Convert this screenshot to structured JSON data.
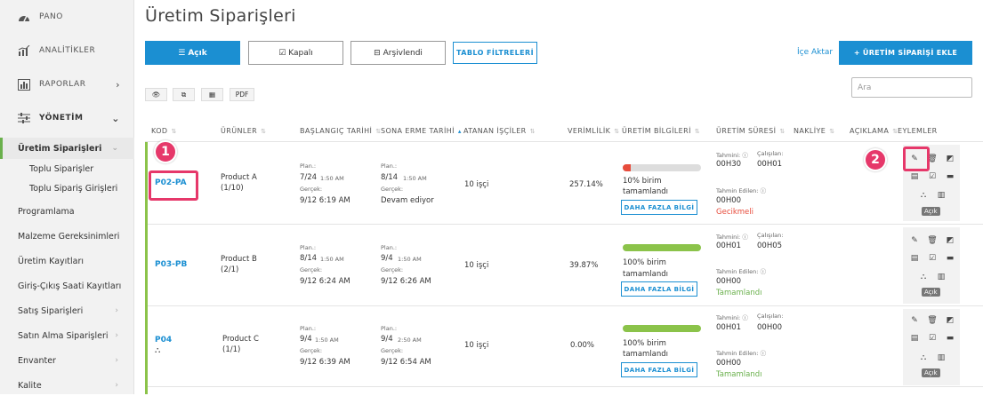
{
  "sidebar": {
    "top": [
      {
        "label": "PANO",
        "icon": "gauge-icon"
      },
      {
        "label": "ANALİTİKLER",
        "icon": "chart-icon"
      },
      {
        "label": "RAPORLAR",
        "icon": "report-icon"
      },
      {
        "label": "YÖNETİM",
        "icon": "sliders-icon"
      }
    ],
    "sub": [
      "Üretim Siparişleri",
      "Toplu Siparişler",
      "Toplu Sipariş Girişleri",
      "Programlama",
      "Malzeme Gereksinimleri",
      "Üretim Kayıtları",
      "Giriş-Çıkış Saati Kayıtları",
      "Satış Siparişleri",
      "Satın Alma Siparişleri",
      "Envanter",
      "Kalite"
    ]
  },
  "page": {
    "title": "Üretim Siparişleri"
  },
  "toolbar": {
    "open": "Açık",
    "closed": "Kapalı",
    "archived": "Arşivlendi",
    "filters": "TABLO FİLTRELERİ",
    "import": "İçe Aktar",
    "add": "+ ÜRETİM SİPARİŞİ EKLE",
    "pdf": "PDF",
    "search_placeholder": "Ara"
  },
  "columns": [
    "KOD",
    "ÜRÜNLER",
    "BAŞLANGIÇ TARİHİ",
    "SONA ERME TARİHİ",
    "ATANAN İŞÇİLER",
    "VERİMLİLİK",
    "ÜRETİM BİLGİLERİ",
    "ÜRETİM SÜRESİ",
    "NAKLİYE",
    "AÇIKLAMA",
    "EYLEMLER"
  ],
  "labels": {
    "plan": "Plan.:",
    "actual": "Gerçek:",
    "estimated": "Tahmini:",
    "worker": "Çalışılan:",
    "estimated_done": "Tahmin Edilen:",
    "more": "DAHA FAZLA BİLGİ",
    "open_badge": "Açık"
  },
  "rows": [
    {
      "code": "P02-PA",
      "product": "Product A",
      "product_qty": "(1/10)",
      "start_plan_date": "7/24",
      "start_plan_time": "1:50 AM",
      "start_actual": "9/12  6:19 AM",
      "end_plan_date": "8/14",
      "end_plan_time": "1:50 AM",
      "end_actual": "Devam ediyor",
      "workers": "10 işçi",
      "efficiency": "257.14%",
      "progress": 0.1,
      "progress_text_1": "10% birim",
      "progress_text_2": "tamamlandı",
      "est": "00H30",
      "worked": "00H01",
      "est_done": "00H00",
      "status": "Gecikmeli",
      "status_color": "#e74c3c"
    },
    {
      "code": "P03-PB",
      "product": "Product B",
      "product_qty": "(2/1)",
      "start_plan_date": "8/14",
      "start_plan_time": "1:50 AM",
      "start_actual": "9/12  6:24 AM",
      "end_plan_date": "9/4",
      "end_plan_time": "1:50 AM",
      "end_actual": "9/12  6:26 AM",
      "workers": "10 işçi",
      "efficiency": "39.87%",
      "progress": 1.0,
      "progress_text_1": "100% birim",
      "progress_text_2": "tamamlandı",
      "est": "00H01",
      "worked": "00H05",
      "est_done": "00H00",
      "status": "Tamamlandı",
      "status_color": "#6ab04c"
    },
    {
      "code": "P04",
      "product": "Product C",
      "product_qty": "(1/1)",
      "start_plan_date": "9/4",
      "start_plan_time": "1:50 AM",
      "start_actual": "9/12  6:39 AM",
      "end_plan_date": "9/4",
      "end_plan_time": "2:50 AM",
      "end_actual": "9/12  6:54 AM",
      "workers": "10 işçi",
      "efficiency": "0.00%",
      "progress": 1.0,
      "progress_text_1": "100% birim",
      "progress_text_2": "tamamlandı",
      "est": "00H01",
      "worked": "00H00",
      "est_done": "00H00",
      "status": "Tamamlandı",
      "status_color": "#6ab04c"
    }
  ],
  "callouts": [
    "1",
    "2"
  ]
}
